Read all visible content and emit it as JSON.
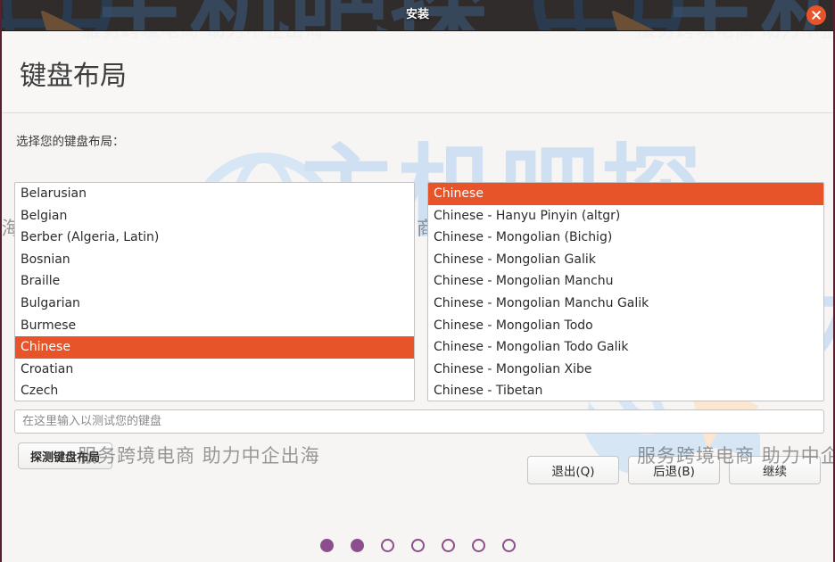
{
  "window": {
    "title": "安装",
    "close_icon": "close-icon",
    "close_label": "×"
  },
  "header": {
    "page_title": "键盘布局"
  },
  "form": {
    "select_label": "选择您的键盘布局：",
    "test_placeholder": "在这里输入以测试您的键盘",
    "test_value": "",
    "detect_button": "探测键盘布局"
  },
  "layout_list": {
    "selected": "Chinese",
    "items": [
      "Belarusian",
      "Belgian",
      "Berber (Algeria, Latin)",
      "Bosnian",
      "Braille",
      "Bulgarian",
      "Burmese",
      "Chinese",
      "Croatian",
      "Czech"
    ]
  },
  "variant_list": {
    "selected": "Chinese",
    "items": [
      "Chinese",
      "Chinese - Hanyu Pinyin (altgr)",
      "Chinese - Mongolian (Bichig)",
      "Chinese - Mongolian Galik",
      "Chinese - Mongolian Manchu",
      "Chinese - Mongolian Manchu Galik",
      "Chinese - Mongolian Todo",
      "Chinese - Mongolian Todo Galik",
      "Chinese - Mongolian Xibe",
      "Chinese - Tibetan"
    ]
  },
  "actions": {
    "quit": "退出(Q)",
    "back": "后退(B)",
    "continue": "继续"
  },
  "progress": {
    "total_steps": 7,
    "current_step": 2,
    "dots": [
      true,
      true,
      false,
      false,
      false,
      false,
      false
    ]
  },
  "watermark": {
    "brand_text": "主机吧探",
    "tagline": "服务跨境电商 助力中企出海",
    "logo_name": "globe-cursor-logo",
    "brand_color": "#cfe0f2",
    "tagline_color": "#d9dde1"
  },
  "colors": {
    "accent": "#e8542a",
    "titlebar": "#2f2c2b",
    "dot_active": "#8e4d8c",
    "window_bg": "#f6f5f4"
  }
}
